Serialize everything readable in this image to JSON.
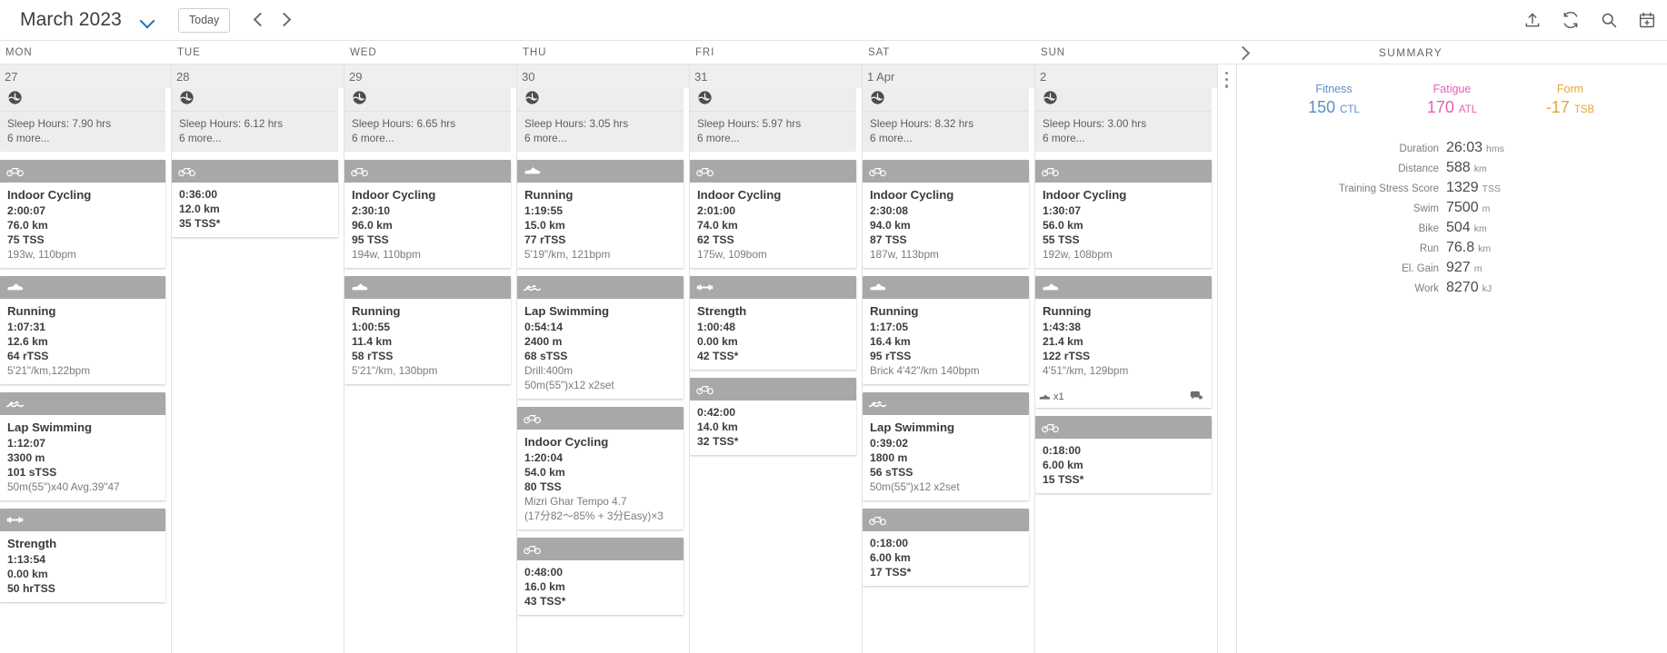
{
  "toolbar": {
    "month_title": "March 2023",
    "today_label": "Today",
    "chevron_down_icon": "chevron-down-icon",
    "prev_icon": "chevron-left-icon",
    "next_icon": "chevron-right-icon",
    "right_icons": [
      "upload-icon",
      "refresh-icon",
      "search-icon",
      "calendar-add-icon"
    ],
    "accent_blue": "#1f6fb4"
  },
  "weekdays": [
    "MON",
    "TUE",
    "WED",
    "THU",
    "FRI",
    "SAT",
    "SUN"
  ],
  "summary_header": {
    "label": "SUMMARY",
    "collapse_icon": "chevron-right-icon"
  },
  "days": [
    {
      "number": "27",
      "metrics": {
        "icon": "sleep-icon",
        "lines": [
          "Sleep Hours: 7.90 hrs",
          "6 more..."
        ]
      },
      "workouts": [
        {
          "icon": "bike-icon",
          "title": "Indoor Cycling",
          "stats": [
            "2:00:07",
            "76.0 km",
            "75 TSS"
          ],
          "note": "193w, 110bpm"
        },
        {
          "icon": "shoe-icon",
          "title": "Running",
          "stats": [
            "1:07:31",
            "12.6 km",
            "64 rTSS"
          ],
          "note": "5'21\"/km,122bpm"
        },
        {
          "icon": "swim-icon",
          "title": "Lap Swimming",
          "stats": [
            "1:12:07",
            "3300 m",
            "101 sTSS"
          ],
          "note": "50m(55\")x40    Avg.39\"47"
        },
        {
          "icon": "strength-icon",
          "title": "Strength",
          "stats": [
            "1:13:54",
            "0.00 km",
            "50 hrTSS"
          ],
          "note": ""
        }
      ]
    },
    {
      "number": "28",
      "metrics": {
        "icon": "sleep-icon",
        "lines": [
          "Sleep Hours: 6.12 hrs",
          "6 more..."
        ]
      },
      "workouts": [
        {
          "icon": "bike-icon",
          "title": "",
          "stats": [
            "0:36:00",
            "12.0 km",
            "35 TSS*"
          ],
          "note": ""
        }
      ]
    },
    {
      "number": "29",
      "metrics": {
        "icon": "sleep-icon",
        "lines": [
          "Sleep Hours: 6.65 hrs",
          "6 more..."
        ]
      },
      "workouts": [
        {
          "icon": "bike-icon",
          "title": "Indoor Cycling",
          "stats": [
            "2:30:10",
            "96.0 km",
            "95 TSS"
          ],
          "note": "194w, 110bpm"
        },
        {
          "icon": "shoe-icon",
          "title": "Running",
          "stats": [
            "1:00:55",
            "11.4 km",
            "58 rTSS"
          ],
          "note": "5'21\"/km, 130bpm"
        }
      ]
    },
    {
      "number": "30",
      "metrics": {
        "icon": "sleep-icon",
        "lines": [
          "Sleep Hours: 3.05 hrs",
          "6 more..."
        ]
      },
      "workouts": [
        {
          "icon": "shoe-icon",
          "title": "Running",
          "stats": [
            "1:19:55",
            "15.0 km",
            "77 rTSS"
          ],
          "note": "5'19\"/km, 121bpm"
        },
        {
          "icon": "swim-icon",
          "title": "Lap Swimming",
          "stats": [
            "0:54:14",
            "2400 m",
            "68 sTSS"
          ],
          "note": "Drill:400m\n50m(55\")x12 x2set"
        },
        {
          "icon": "bike-icon",
          "title": "Indoor Cycling",
          "stats": [
            "1:20:04",
            "54.0 km",
            "80 TSS"
          ],
          "note": "Mizri Ghar Tempo 4.7\n(17分82〜85% + 3分Easy)×3"
        },
        {
          "icon": "bike-icon",
          "title": "",
          "stats": [
            "0:48:00",
            "16.0 km",
            "43 TSS*"
          ],
          "note": ""
        }
      ]
    },
    {
      "number": "31",
      "metrics": {
        "icon": "sleep-icon",
        "lines": [
          "Sleep Hours: 5.97 hrs",
          "6 more..."
        ]
      },
      "workouts": [
        {
          "icon": "bike-icon",
          "title": "Indoor Cycling",
          "stats": [
            "2:01:00",
            "74.0 km",
            "62 TSS"
          ],
          "note": "175w, 109bom"
        },
        {
          "icon": "strength-icon",
          "title": "Strength",
          "stats": [
            "1:00:48",
            "0.00 km",
            "42 TSS*"
          ],
          "note": ""
        },
        {
          "icon": "bike-icon",
          "title": "",
          "stats": [
            "0:42:00",
            "14.0 km",
            "32 TSS*"
          ],
          "note": ""
        }
      ]
    },
    {
      "number": "1 Apr",
      "metrics": {
        "icon": "sleep-icon",
        "lines": [
          "Sleep Hours: 8.32 hrs",
          "6 more..."
        ]
      },
      "workouts": [
        {
          "icon": "bike-icon",
          "title": "Indoor Cycling",
          "stats": [
            "2:30:08",
            "94.0 km",
            "87 TSS"
          ],
          "note": "187w, 113bpm"
        },
        {
          "icon": "shoe-icon",
          "title": "Running",
          "stats": [
            "1:17:05",
            "16.4 km",
            "95 rTSS"
          ],
          "note": "Brick 4'42\"/km 140bpm"
        },
        {
          "icon": "swim-icon",
          "title": "Lap Swimming",
          "stats": [
            "0:39:02",
            "1800 m",
            "56 sTSS"
          ],
          "note": "50m(55\")x12 x2set"
        },
        {
          "icon": "bike-icon",
          "title": "",
          "stats": [
            "0:18:00",
            "6.00 km",
            "17 TSS*"
          ],
          "note": ""
        }
      ]
    },
    {
      "number": "2",
      "metrics": {
        "icon": "sleep-icon",
        "lines": [
          "Sleep Hours: 3.00 hrs",
          "6 more..."
        ]
      },
      "workouts": [
        {
          "icon": "bike-icon",
          "title": "Indoor Cycling",
          "stats": [
            "1:30:07",
            "56.0 km",
            "55 TSS"
          ],
          "note": "192w, 108bpm"
        },
        {
          "icon": "shoe-icon",
          "title": "Running",
          "stats": [
            "1:43:38",
            "21.4 km",
            "122 rTSS"
          ],
          "note": "4'51\"/km, 129bpm",
          "footer": {
            "shoe_badge": "x1",
            "comment_icon": "comment-icon"
          }
        },
        {
          "icon": "bike-icon",
          "title": "",
          "stats": [
            "0:18:00",
            "6.00 km",
            "15 TSS*"
          ],
          "note": ""
        }
      ]
    }
  ],
  "summary": {
    "pmc": [
      {
        "label": "Fitness",
        "value": "150",
        "unit": "CTL",
        "color": "#5b8fc9"
      },
      {
        "label": "Fatigue",
        "value": "170",
        "unit": "ATL",
        "color": "#e85fb5"
      },
      {
        "label": "Form",
        "value": "-17",
        "unit": "TSB",
        "color": "#e9a53a"
      }
    ],
    "rows": [
      {
        "key": "Duration",
        "value": "26:03",
        "unit": "hms"
      },
      {
        "key": "Distance",
        "value": "588",
        "unit": "km"
      },
      {
        "key": "Training Stress Score",
        "value": "1329",
        "unit": "TSS"
      },
      {
        "key": "Swim",
        "value": "7500",
        "unit": "m"
      },
      {
        "key": "Bike",
        "value": "504",
        "unit": "km"
      },
      {
        "key": "Run",
        "value": "76.8",
        "unit": "km"
      },
      {
        "key": "El. Gain",
        "value": "927",
        "unit": "m"
      },
      {
        "key": "Work",
        "value": "8270",
        "unit": "kJ"
      }
    ]
  }
}
